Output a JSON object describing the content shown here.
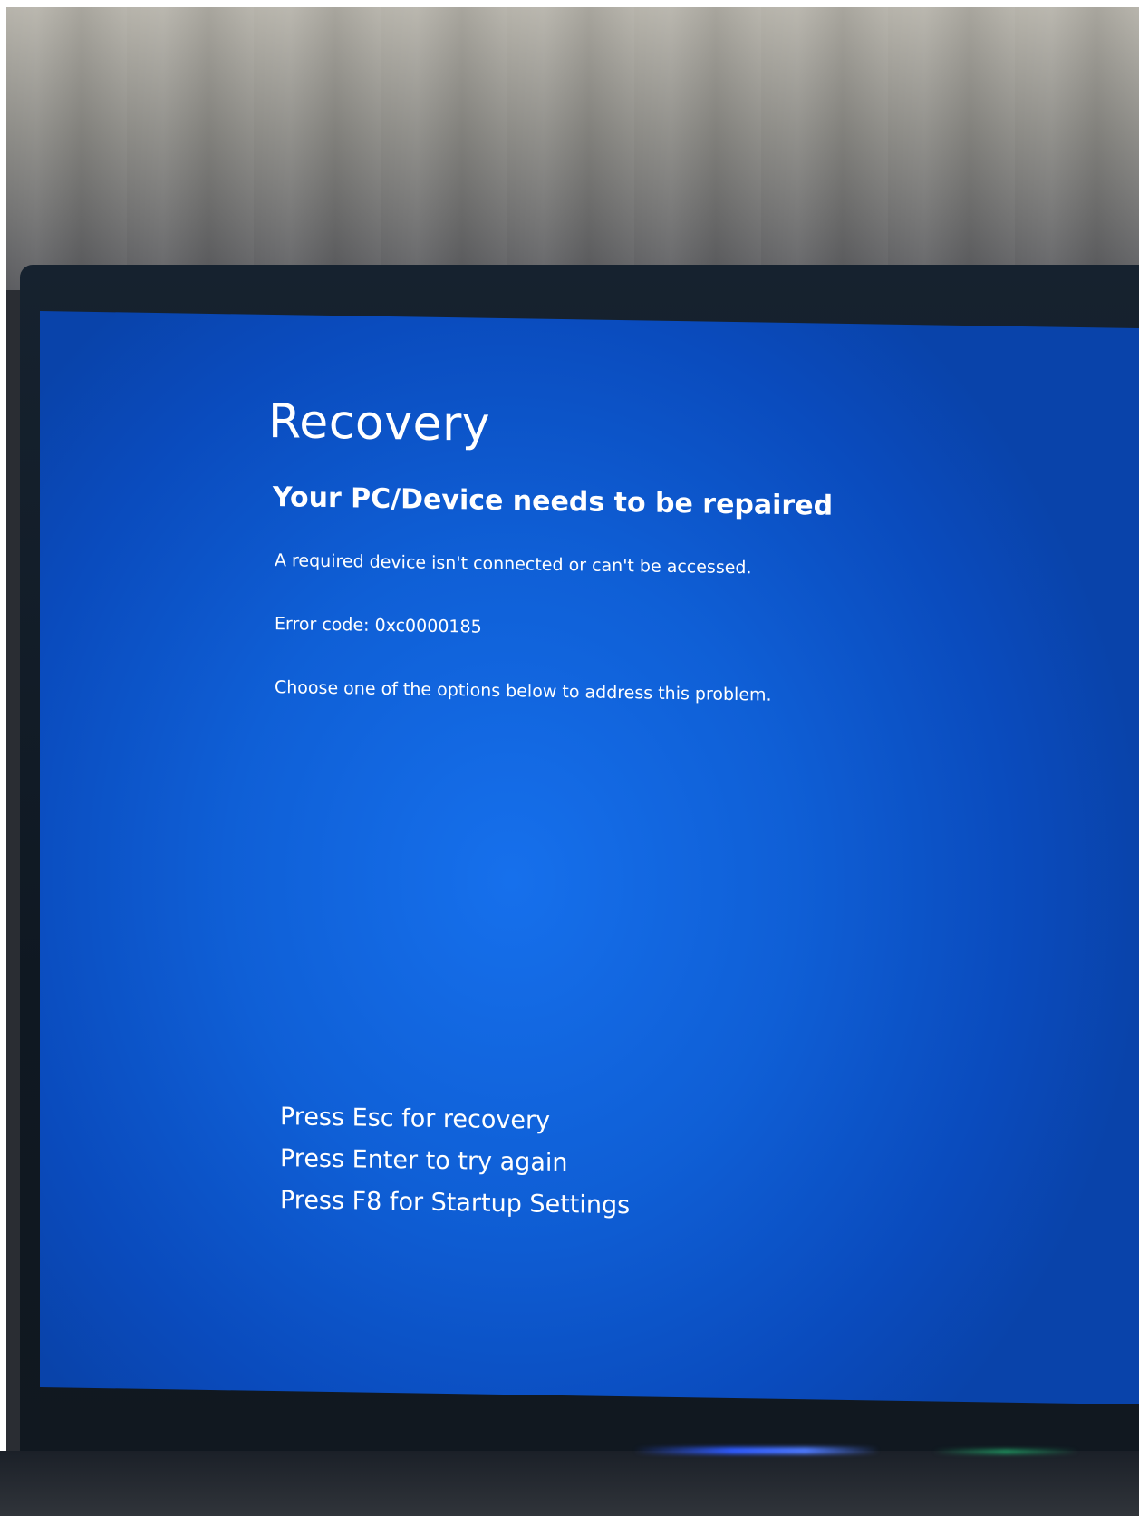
{
  "screen": {
    "background_color": "#0f5fd6",
    "text_color": "#ffffff",
    "title": "Recovery",
    "subtitle": "Your PC/Device needs to be repaired",
    "message": "A required device isn't connected or can't be accessed.",
    "error_code": "Error code: 0xc0000185",
    "instruction": "Choose one of the options below to address this problem.",
    "options": [
      {
        "label": "Press Esc for recovery"
      },
      {
        "label": "Press Enter to try again"
      },
      {
        "label": "Press F8 for Startup Settings"
      }
    ]
  }
}
